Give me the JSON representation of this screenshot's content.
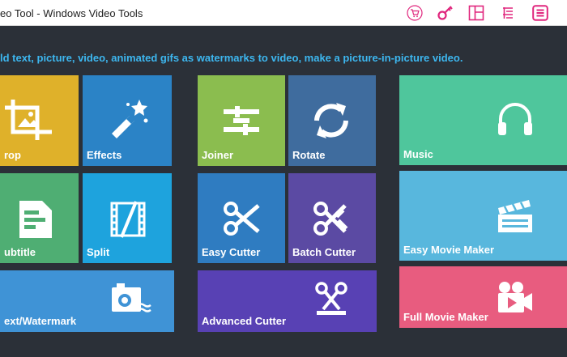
{
  "window": {
    "title": "eo Tool - Windows Video Tools"
  },
  "toolbar": {
    "icons": [
      "cart-icon",
      "key-icon",
      "layout-icon",
      "list-icon",
      "menu-icon"
    ],
    "accent": "#e0267d"
  },
  "banner": {
    "text": "ld text, picture, video, animated gifs as watermarks to video, make a picture-in-picture video."
  },
  "tiles": [
    {
      "label": "rop",
      "icon": "crop-icon",
      "color": "#dfb12a"
    },
    {
      "label": "Effects",
      "icon": "magic-wand-icon",
      "color": "#2b83c6"
    },
    {
      "label": "ubtitle",
      "icon": "subtitle-icon",
      "color": "#4fae73"
    },
    {
      "label": "Split",
      "icon": "film-split-icon",
      "color": "#1ea3dd"
    },
    {
      "label": "ext/Watermark",
      "icon": "watermark-camera-icon",
      "color": "#3f93d6"
    },
    {
      "label": "Joiner",
      "icon": "joiner-icon",
      "color": "#8bbd4f"
    },
    {
      "label": "Rotate",
      "icon": "rotate-icon",
      "color": "#3f6c9e"
    },
    {
      "label": "Easy Cutter",
      "icon": "scissors-icon",
      "color": "#2f7cc1"
    },
    {
      "label": "Batch Cutter",
      "icon": "batch-scissors-icon",
      "color": "#5b4aa3"
    },
    {
      "label": "Advanced Cutter",
      "icon": "advanced-scissors-icon",
      "color": "#5841b4"
    },
    {
      "label": "Music",
      "icon": "headphones-icon",
      "color": "#4fc69c"
    },
    {
      "label": "Easy Movie Maker",
      "icon": "clapperboard-icon",
      "color": "#58b7dd"
    },
    {
      "label": "Full Movie Maker",
      "icon": "video-camera-icon",
      "color": "#e85c7f"
    }
  ]
}
